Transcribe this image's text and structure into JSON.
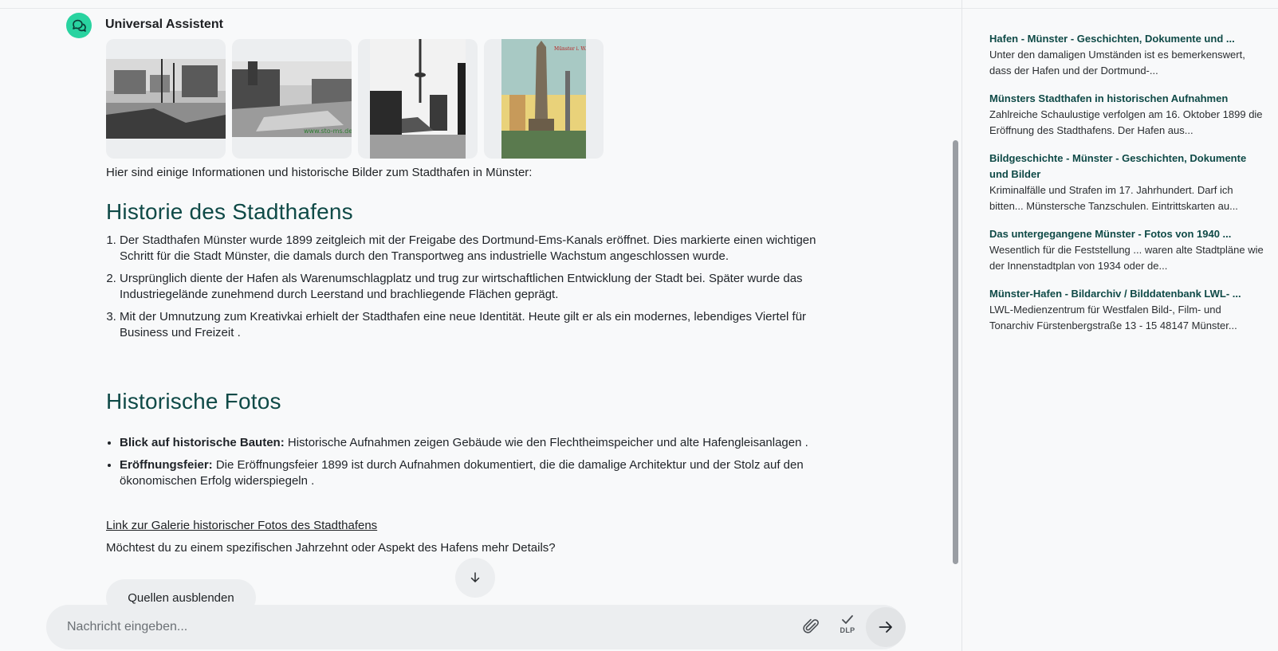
{
  "assistant": {
    "name": "Universal Assistent"
  },
  "images": [
    {
      "icon": "harbor-ships-photo"
    },
    {
      "icon": "harbor-canal-photo"
    },
    {
      "icon": "tv-tower-harbor-photo"
    },
    {
      "icon": "monument-postcard-photo"
    }
  ],
  "message": {
    "intro": "Hier sind einige Informationen und historische Bilder zum Stadthafen in Münster:",
    "section1_title": "Historie des Stadthafens",
    "points": [
      "Der Stadthafen Münster wurde 1899 zeitgleich mit der Freigabe des Dortmund-Ems-Kanals eröffnet. Dies markierte einen wichtigen Schritt für die Stadt Münster, die damals durch den Transportweg ans industrielle Wachstum angeschlossen wurde.",
      "Ursprünglich diente der Hafen als Warenumschlagplatz und trug zur wirtschaftlichen Entwicklung der Stadt bei. Später wurde das Industriegelände zunehmend durch Leerstand und brachliegende Flächen geprägt.",
      "Mit der Umnutzung zum Kreativkai erhielt der Stadthafen eine neue Identität. Heute gilt er als ein modernes, lebendiges Viertel für Business und Freizeit ."
    ],
    "section2_title": "Historische Fotos",
    "fotos": [
      {
        "label": "Blick auf historische Bauten:",
        "text": " Historische Aufnahmen zeigen Gebäude wie den Flechtheimspeicher und alte Hafengleisanlagen ."
      },
      {
        "label": "Eröffnungsfeier:",
        "text": " Die Eröffnungsfeier 1899 ist durch Aufnahmen dokumentiert, die die damalige Architektur und der Stolz auf den ökonomischen Erfolg widerspiegeln ."
      }
    ],
    "gallery_link": "Link zur Galerie historischer Fotos des Stadthafens",
    "question": "Möchtest du zu einem spezifischen Jahrzehnt oder Aspekt des Hafens mehr Details?"
  },
  "buttons": {
    "sources_toggle": "Quellen ausblenden",
    "dlp_label": "DLP"
  },
  "composer": {
    "placeholder": "Nachricht eingeben..."
  },
  "sources": [
    {
      "title": "Hafen - Münster - Geschichten, Dokumente und ...",
      "snippet": "Unter den damaligen Umständen ist es bemerkenswert, dass der Hafen und der Dortmund-..."
    },
    {
      "title": "Münsters Stadthafen in historischen Aufnahmen",
      "snippet": "Zahlreiche Schaulustige verfolgen am 16. Oktober 1899 die Eröffnung des Stadthafens. Der Hafen aus..."
    },
    {
      "title": "Bildgeschichte - Münster - Geschichten, Dokumente und Bilder",
      "snippet": "Kriminalfälle und Strafen im 17. Jahrhundert. Darf ich bitten... Münstersche Tanzschulen. Eintrittskarten au..."
    },
    {
      "title": "Das untergegangene Münster - Fotos von 1940 ...",
      "snippet": "Wesentlich für die Feststellung ... waren alte Stadtpläne wie der Innenstadtplan von 1934 oder de..."
    },
    {
      "title": "Münster-Hafen - Bildarchiv / Bilddatenbank LWL- ...",
      "snippet": "LWL-Medienzentrum für Westfalen Bild-, Film- und Tonarchiv Fürstenbergstraße 13 - 15 48147 Münster..."
    }
  ],
  "colors": {
    "accent": "#29d3a0",
    "heading": "#0f4a47"
  }
}
